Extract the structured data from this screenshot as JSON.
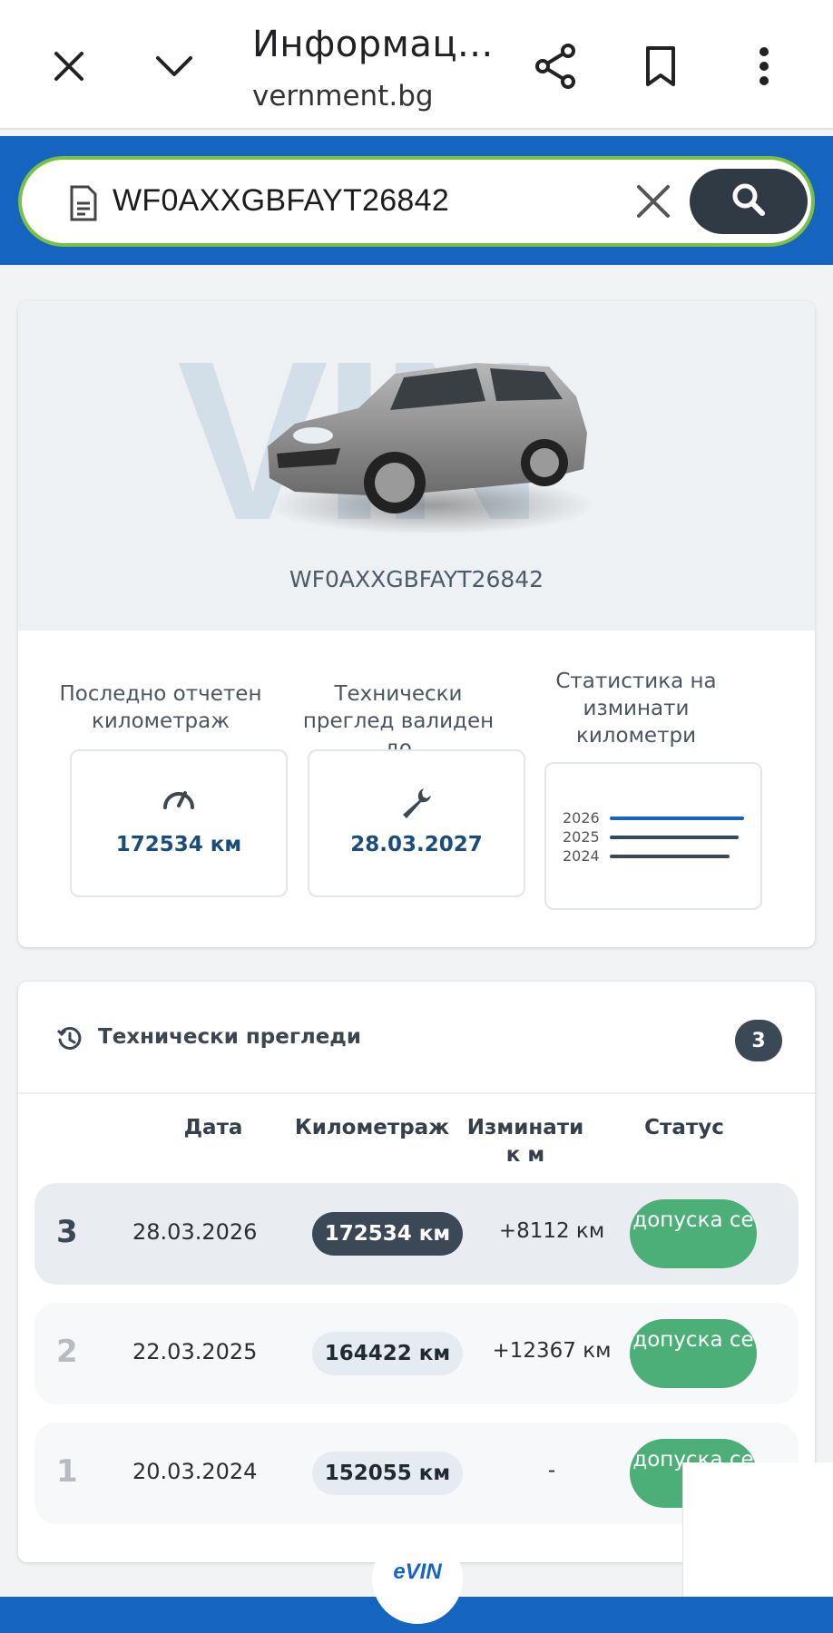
{
  "browser": {
    "title": "Информац...",
    "url": "vernment.bg"
  },
  "search": {
    "value": "WF0AXXGBFAYT26842"
  },
  "vehicle": {
    "vin_watermark": "VIN",
    "vin": "WF0AXXGBFAYT26842"
  },
  "stats": {
    "mileage_label": "Последно отчетен километраж",
    "mileage_value": "172534 км",
    "inspection_label": "Технически преглед валиден до",
    "inspection_value": "28.03.2027",
    "chart_label": "Статистика на изминати километри",
    "chart_years": [
      "2026",
      "2025",
      "2024"
    ]
  },
  "inspections": {
    "title": "Технически прегледи",
    "count": "3",
    "headers": {
      "date": "Дата",
      "mileage": "Километраж",
      "delta": "Изминати к м",
      "status": "Статус"
    },
    "rows": [
      {
        "num": "3",
        "date": "28.03.2026",
        "km": "172534 км",
        "delta": "+8112 км",
        "status": "допуска се"
      },
      {
        "num": "2",
        "date": "22.03.2025",
        "km": "164422 км",
        "delta": "+12367 км",
        "status": "допуска се"
      },
      {
        "num": "1",
        "date": "20.03.2024",
        "km": "152055 км",
        "delta": "-",
        "status": "допуска се"
      }
    ]
  },
  "footer": {
    "logo": "eVIN"
  },
  "colors": {
    "brand_blue": "#1565c0",
    "search_border": "#7ac143",
    "status_green": "#4caf78",
    "dark": "#2f3a45"
  }
}
